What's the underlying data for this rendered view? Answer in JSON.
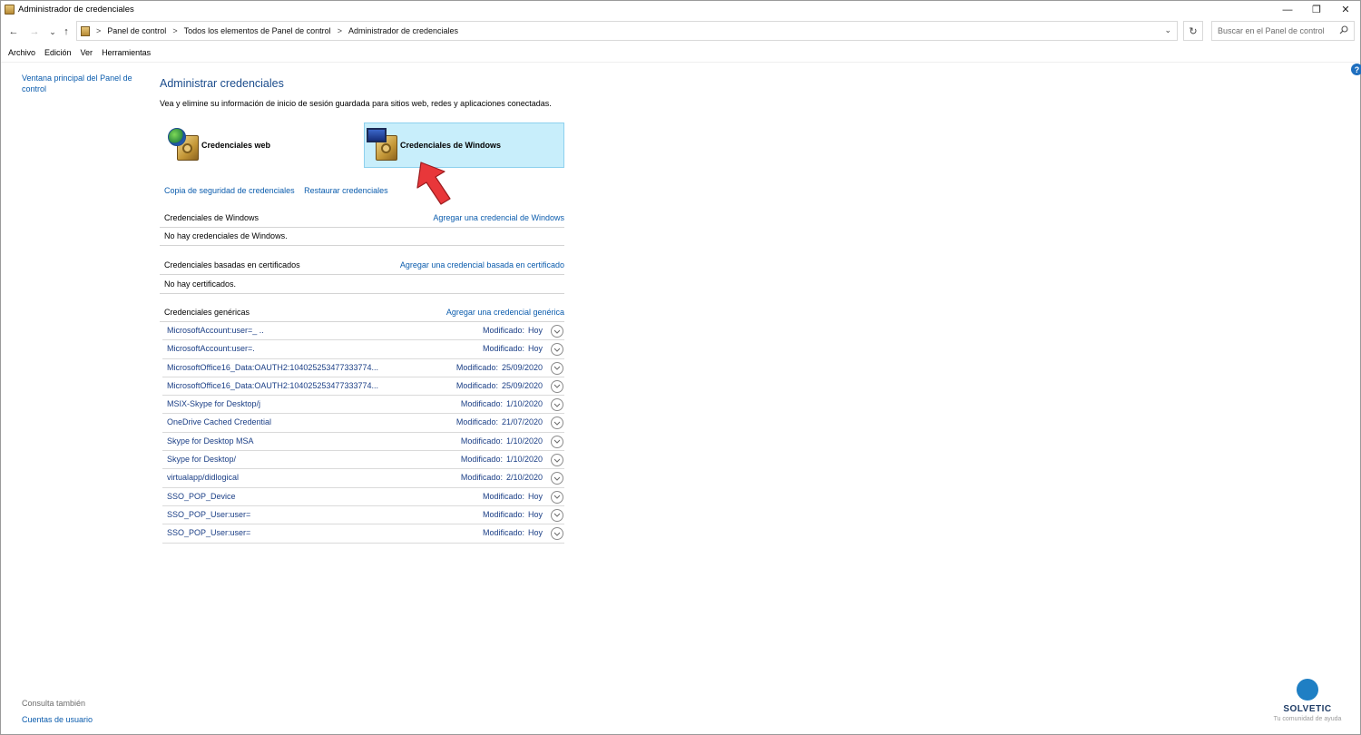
{
  "window": {
    "title": "Administrador de credenciales",
    "controls": {
      "minimize": "—",
      "restore": "❐",
      "close": "✕"
    }
  },
  "nav": {
    "back": "←",
    "forward": "→",
    "recent": "⌄",
    "up": "↑",
    "breadcrumbs": [
      "Panel de control",
      "Todos los elementos de Panel de control",
      "Administrador de credenciales"
    ],
    "separator": ">",
    "refresh": "↻",
    "search_placeholder": "Buscar en el Panel de control"
  },
  "menu": [
    "Archivo",
    "Edición",
    "Ver",
    "Herramientas"
  ],
  "sidebar": {
    "home_link": "Ventana principal del Panel de control",
    "see_also_title": "Consulta también",
    "see_also_link": "Cuentas de usuario"
  },
  "main": {
    "title": "Administrar credenciales",
    "description": "Vea y elimine su información de inicio de sesión guardada para sitios web, redes y aplicaciones conectadas.",
    "tiles": {
      "web": "Credenciales web",
      "windows": "Credenciales de Windows"
    },
    "links": {
      "backup": "Copia de seguridad de credenciales",
      "restore": "Restaurar credenciales"
    },
    "sections": {
      "windows": {
        "title": "Credenciales de Windows",
        "add": "Agregar una credencial de Windows",
        "empty": "No hay credenciales de Windows."
      },
      "certificate": {
        "title": "Credenciales basadas en certificados",
        "add": "Agregar una credencial basada en certificado",
        "empty": "No hay certificados."
      },
      "generic": {
        "title": "Credenciales genéricas",
        "add": "Agregar una credencial genérica",
        "modified_label": "Modificado:",
        "items": [
          {
            "name": "MicrosoftAccount:user=_                                 ..",
            "date": "Hoy"
          },
          {
            "name": "MicrosoftAccount:user=.",
            "date": "Hoy"
          },
          {
            "name": "MicrosoftOffice16_Data:OAUTH2:1040252534773337​74...",
            "date": "25/09/2020"
          },
          {
            "name": "MicrosoftOffice16_Data:OAUTH2:1040252534773337​74...",
            "date": "25/09/2020"
          },
          {
            "name": "MSIX-Skype for Desktop/j",
            "date": "1/10/2020"
          },
          {
            "name": "OneDrive Cached Credential",
            "date": "21/07/2020"
          },
          {
            "name": "Skype for Desktop MSA",
            "date": "1/10/2020"
          },
          {
            "name": "Skype for Desktop/",
            "date": "1/10/2020"
          },
          {
            "name": "virtualapp/didlogical",
            "date": "2/10/2020"
          },
          {
            "name": "SSO_POP_Device",
            "date": "Hoy"
          },
          {
            "name": "SSO_POP_User:user=",
            "date": "Hoy"
          },
          {
            "name": "SSO_POP_User:user=",
            "date": "Hoy"
          }
        ]
      }
    }
  },
  "help": "?",
  "watermark": {
    "brand": "SOLVETIC",
    "tagline": "Tu comunidad de ayuda"
  },
  "colors": {
    "link": "#0b5cad",
    "selected_tile": "#c8eefb",
    "arrow": "#e8373a",
    "title": "#1b4c8c"
  }
}
